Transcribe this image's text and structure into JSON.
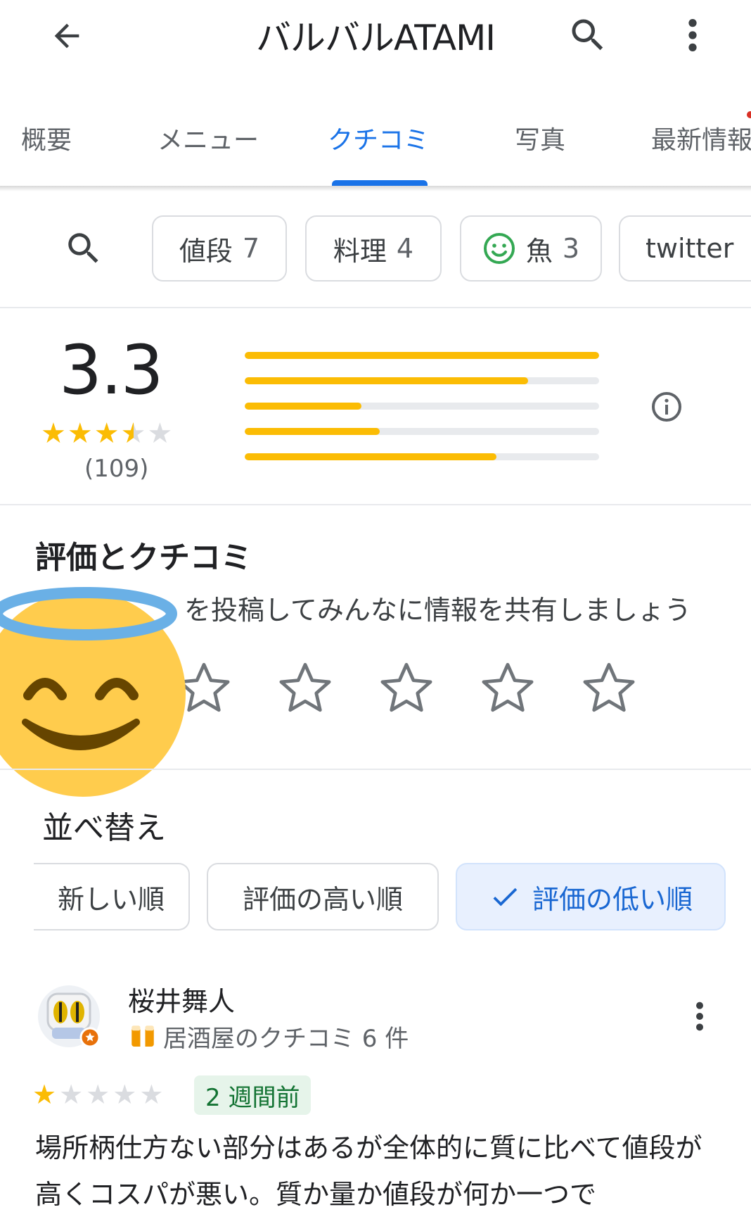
{
  "app_bar": {
    "title": "バルバルATAMI",
    "back_icon": "arrow-back-icon",
    "search_icon": "search-icon",
    "more_icon": "more-vert-icon"
  },
  "tabs": [
    {
      "label": "概要"
    },
    {
      "label": "メニュー"
    },
    {
      "label": "クチコミ",
      "active": true
    },
    {
      "label": "写真"
    },
    {
      "label": "最新情報"
    }
  ],
  "chips": [
    {
      "label": "値段",
      "count": "7"
    },
    {
      "label": "料理",
      "count": "4"
    },
    {
      "label": "魚",
      "count": "3",
      "icon": "smile-icon"
    },
    {
      "label": "twitter",
      "count": ""
    }
  ],
  "summary": {
    "rating": "3.3",
    "stars_value": 3.3,
    "review_count": "(109)",
    "distribution_fraction": [
      1.0,
      0.8,
      0.33,
      0.38,
      0.71
    ]
  },
  "rate_section": {
    "title": "評価とクチコミ",
    "prompt": "を投稿してみんなに情報を共有しましょう"
  },
  "sort": {
    "title": "並べ替え",
    "options": [
      "新しい順",
      "評価の高い順",
      "評価の低い順"
    ],
    "selected": "評価の低い順"
  },
  "review": {
    "author": "桜井舞人",
    "meta": "居酒屋のクチコミ 6 件",
    "stars": 1,
    "time": "2 週間前",
    "text": "場所柄仕方ない部分はあるが全体的に質に比べて値段が高くコスパが悪い。質か量か値段が何か一つで"
  },
  "colors": {
    "accent": "#1a73e8",
    "star": "#fbbc04",
    "star_empty": "#dadce0"
  }
}
